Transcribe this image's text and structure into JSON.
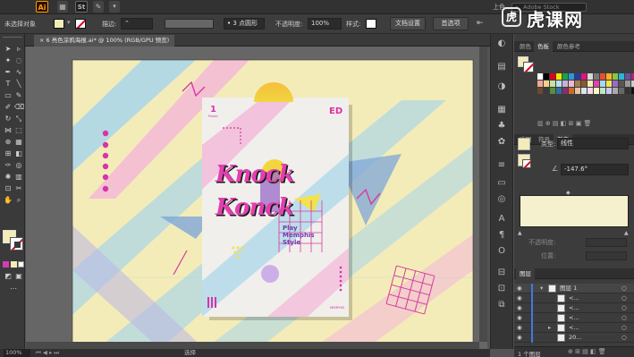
{
  "app": {
    "name": "Ai",
    "badge1": "St",
    "search_placeholder": "Adobe Stock",
    "user_menu": "上色"
  },
  "watermark": {
    "text": "虎课网"
  },
  "control_bar": {
    "selection_label": "未选择对象",
    "stroke_label": "描边:",
    "brush_value": "3 点圆形",
    "opacity_label": "不透明度:",
    "opacity_value": "100%",
    "style_label": "样式:",
    "doc_setup_button": "文档设置",
    "prefs_button": "首选项"
  },
  "document": {
    "tab_title": "6 亮色涂鸦海报.ai* @ 100% (RGB/GPU 预览)",
    "close_icon": "×"
  },
  "status_bar": {
    "zoom": "100%",
    "tool": "选择"
  },
  "poster": {
    "page_number": "1",
    "page_caption": "Poster",
    "corner_mark": "ED",
    "headline_1": "Knock",
    "headline_2": "Konck",
    "sub_1": "Play",
    "sub_2": "Memphis",
    "sub_3": "Style",
    "footer_tag": "MEMPHIS"
  },
  "color_panel": {
    "tabs": [
      "颜色",
      "色板",
      "颜色参考"
    ],
    "active": 1
  },
  "gradient_panel": {
    "tabs": [
      "透明",
      "符号",
      "渐变"
    ],
    "active": 2,
    "type_label": "类型:",
    "type_value": "线性",
    "angle_value": "-147.6°",
    "opacity_label": "不透明度:",
    "position_label": "位置:"
  },
  "layers_panel": {
    "tab": "图层",
    "items": [
      {
        "name": "图层 1",
        "expanded": true
      },
      {
        "name": "<..."
      },
      {
        "name": "<..."
      },
      {
        "name": "<..."
      },
      {
        "name": "<..."
      },
      {
        "name": "20..."
      }
    ],
    "footer": "1 个图层"
  },
  "colors": {
    "artboard_bg": "#f4ecb8",
    "poster_bg": "#f0efec",
    "magenta": "#e23fb0",
    "pink": "#f07fc0",
    "light_blue": "#a8d6ea",
    "yellow": "#f2e24e",
    "gradient_fill": "#f5f1cf"
  }
}
